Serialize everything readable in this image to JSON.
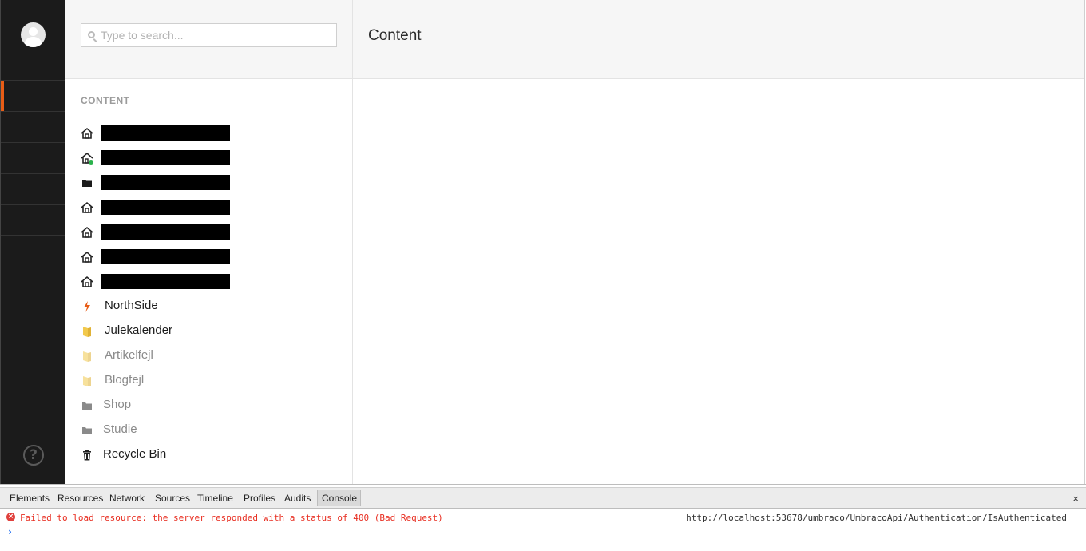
{
  "search": {
    "placeholder": "Type to search..."
  },
  "tree": {
    "title": "CONTENT",
    "items": [
      {
        "label": "",
        "icon": "home-icon",
        "redacted": true
      },
      {
        "label": "",
        "icon": "home-published-icon",
        "redacted": true
      },
      {
        "label": "",
        "icon": "folder-dark-icon",
        "redacted": true
      },
      {
        "label": "",
        "icon": "home-icon",
        "redacted": true
      },
      {
        "label": "",
        "icon": "home-icon",
        "redacted": true
      },
      {
        "label": "",
        "icon": "home-icon",
        "redacted": true
      },
      {
        "label": "",
        "icon": "home-icon",
        "redacted": true
      },
      {
        "label": "NorthSide",
        "icon": "lightning-icon"
      },
      {
        "label": "Julekalender",
        "icon": "yellow-folder-icon"
      },
      {
        "label": "Artikelfejl",
        "icon": "yellow-folder-icon",
        "dimmed": true
      },
      {
        "label": "Blogfejl",
        "icon": "yellow-folder-icon",
        "dimmed": true
      },
      {
        "label": "Shop",
        "icon": "folder-icon",
        "dimmed": true
      },
      {
        "label": "Studie",
        "icon": "folder-icon",
        "dimmed": true
      },
      {
        "label": "Recycle Bin",
        "icon": "trash-icon"
      }
    ]
  },
  "main": {
    "title": "Content"
  },
  "devtools": {
    "tabs": [
      "Elements",
      "Resources",
      "Network",
      "Sources",
      "Timeline",
      "Profiles",
      "Audits",
      "Console"
    ],
    "active_tab": "Console",
    "close": "×",
    "error_message": "Failed to load resource: the server responded with a status of 400 (Bad Request)",
    "error_source": "http://localhost:53678/umbraco/UmbracoApi/Authentication/IsAuthenticated",
    "prompt": "›"
  },
  "colors": {
    "accent": "#e85d16",
    "sidebar": "#1b1b1b",
    "error": "#e82e21"
  }
}
